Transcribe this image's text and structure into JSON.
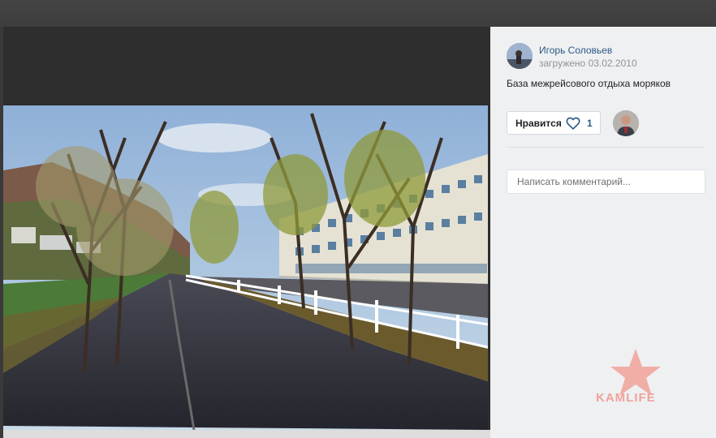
{
  "author": {
    "name": "Игорь Соловьев",
    "upload_prefix": "загружено",
    "upload_date": "03.02.2010"
  },
  "photo": {
    "caption": "База межрейсового отдыха моряков"
  },
  "likes": {
    "button_label": "Нравится",
    "count": "1"
  },
  "comment": {
    "placeholder": "Написать комментарий..."
  },
  "watermark": {
    "text": "KAMLIFE"
  },
  "icons": {
    "like": "heart-icon",
    "watermark": "star-icon"
  },
  "colors": {
    "link": "#2a5885",
    "panel_bg": "#eff0f2",
    "viewer_bg": "#2e2e2e",
    "watermark": "#f0a29a"
  }
}
